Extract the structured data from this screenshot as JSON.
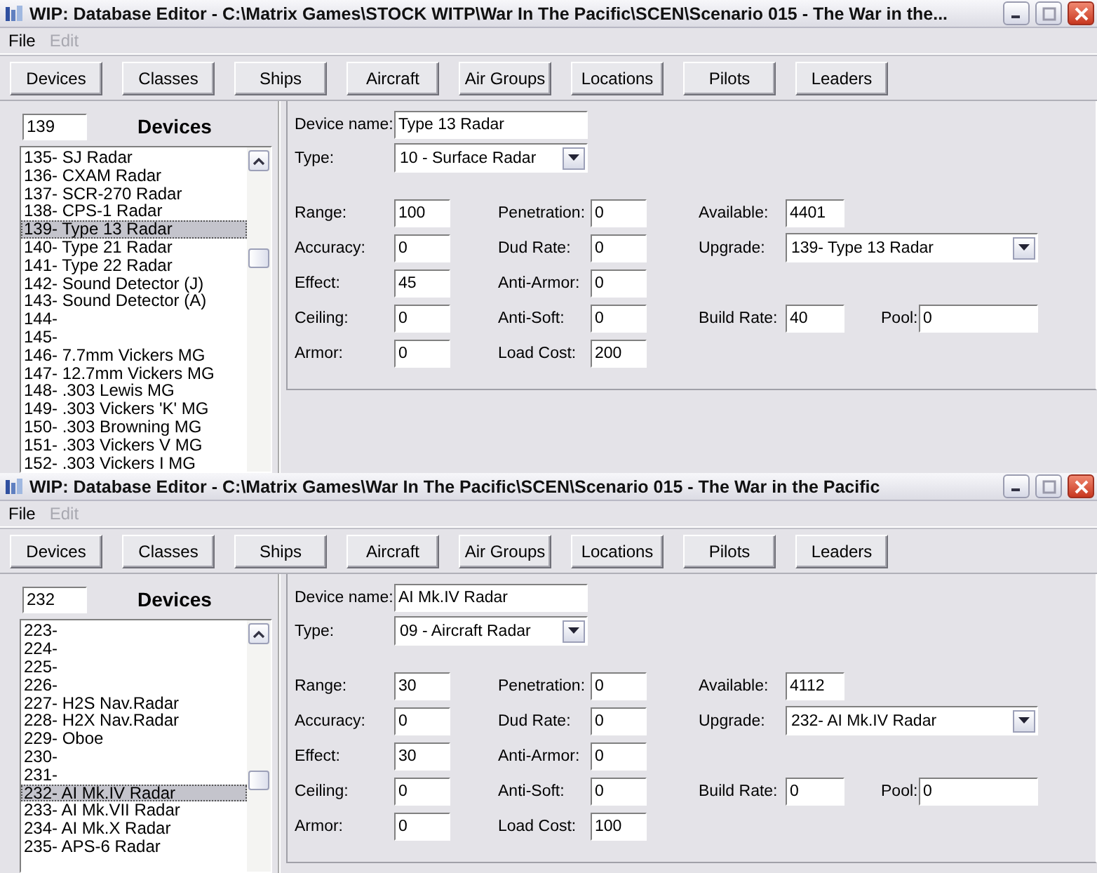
{
  "windows": [
    {
      "title": "WIP: Database Editor - C:\\Matrix Games\\STOCK WITP\\War In The Pacific\\SCEN\\Scenario 015 - The War in the...",
      "menu": [
        {
          "label": "File",
          "disabled": false
        },
        {
          "label": "Edit",
          "disabled": true
        }
      ],
      "nav_buttons": [
        "Devices",
        "Classes",
        "Ships",
        "Aircraft",
        "Air Groups",
        "Locations",
        "Pilots",
        "Leaders"
      ],
      "search": {
        "value": "139"
      },
      "list_title": "Devices",
      "list": [
        {
          "label": "135- SJ Radar",
          "selected": false
        },
        {
          "label": "136- CXAM Radar",
          "selected": false
        },
        {
          "label": "137- SCR-270 Radar",
          "selected": false
        },
        {
          "label": "138- CPS-1 Radar",
          "selected": false
        },
        {
          "label": "139- Type 13 Radar",
          "selected": true
        },
        {
          "label": "140- Type 21 Radar",
          "selected": false
        },
        {
          "label": "141- Type 22 Radar",
          "selected": false
        },
        {
          "label": "142- Sound Detector (J)",
          "selected": false
        },
        {
          "label": "143- Sound Detector (A)",
          "selected": false
        },
        {
          "label": "144-",
          "selected": false
        },
        {
          "label": "145-",
          "selected": false
        },
        {
          "label": "146- 7.7mm Vickers MG",
          "selected": false
        },
        {
          "label": "147- 12.7mm Vickers MG",
          "selected": false
        },
        {
          "label": "148- .303 Lewis MG",
          "selected": false
        },
        {
          "label": "149- .303 Vickers 'K' MG",
          "selected": false
        },
        {
          "label": "150- .303 Browning MG",
          "selected": false
        },
        {
          "label": "151- .303 Vickers V MG",
          "selected": false
        },
        {
          "label": "152- .303 Vickers I MG",
          "selected": false
        }
      ],
      "device_name": {
        "label": "Device name:",
        "value": "Type 13 Radar"
      },
      "type": {
        "label": "Type:",
        "value": "10 - Surface Radar"
      },
      "stat_rows": [
        [
          {
            "kind": "field",
            "label": "Range:",
            "value": "100"
          },
          {
            "kind": "field",
            "label": "Penetration:",
            "value": "0"
          },
          {
            "kind": "field",
            "label": "Available:",
            "value": "4401"
          },
          null
        ],
        [
          {
            "kind": "field",
            "label": "Accuracy:",
            "value": "0"
          },
          {
            "kind": "field",
            "label": "Dud Rate:",
            "value": "0"
          },
          {
            "kind": "dropdown",
            "label": "Upgrade:",
            "value": "139- Type 13 Radar"
          },
          null
        ],
        [
          {
            "kind": "field",
            "label": "Effect:",
            "value": "45"
          },
          {
            "kind": "field",
            "label": "Anti-Armor:",
            "value": "0"
          },
          null,
          null
        ],
        [
          {
            "kind": "field",
            "label": "Ceiling:",
            "value": "0"
          },
          {
            "kind": "field",
            "label": "Anti-Soft:",
            "value": "0"
          },
          {
            "kind": "field",
            "label": "Build Rate:",
            "value": "40"
          },
          {
            "kind": "field",
            "label": "Pool:",
            "value": "0"
          }
        ],
        [
          {
            "kind": "field",
            "label": "Armor:",
            "value": "0"
          },
          {
            "kind": "field",
            "label": "Load Cost:",
            "value": "200"
          },
          null,
          null
        ]
      ]
    },
    {
      "title": "WIP: Database Editor - C:\\Matrix Games\\War In The Pacific\\SCEN\\Scenario 015 - The War in the Pacific",
      "menu": [
        {
          "label": "File",
          "disabled": false
        },
        {
          "label": "Edit",
          "disabled": true
        }
      ],
      "nav_buttons": [
        "Devices",
        "Classes",
        "Ships",
        "Aircraft",
        "Air Groups",
        "Locations",
        "Pilots",
        "Leaders"
      ],
      "search": {
        "value": "232"
      },
      "list_title": "Devices",
      "list": [
        {
          "label": "223-",
          "selected": false
        },
        {
          "label": "224-",
          "selected": false
        },
        {
          "label": "225-",
          "selected": false
        },
        {
          "label": "226-",
          "selected": false
        },
        {
          "label": "227- H2S Nav.Radar",
          "selected": false
        },
        {
          "label": "228- H2X Nav.Radar",
          "selected": false
        },
        {
          "label": "229- Oboe",
          "selected": false
        },
        {
          "label": "230-",
          "selected": false
        },
        {
          "label": "231-",
          "selected": false
        },
        {
          "label": "232- AI Mk.IV Radar",
          "selected": true
        },
        {
          "label": "233- AI Mk.VII Radar",
          "selected": false
        },
        {
          "label": "234- AI Mk.X Radar",
          "selected": false
        },
        {
          "label": "235- APS-6 Radar",
          "selected": false
        }
      ],
      "device_name": {
        "label": "Device name:",
        "value": "AI Mk.IV Radar"
      },
      "type": {
        "label": "Type:",
        "value": "09 - Aircraft Radar"
      },
      "stat_rows": [
        [
          {
            "kind": "field",
            "label": "Range:",
            "value": "30"
          },
          {
            "kind": "field",
            "label": "Penetration:",
            "value": "0"
          },
          {
            "kind": "field",
            "label": "Available:",
            "value": "4112"
          },
          null
        ],
        [
          {
            "kind": "field",
            "label": "Accuracy:",
            "value": "0"
          },
          {
            "kind": "field",
            "label": "Dud Rate:",
            "value": "0"
          },
          {
            "kind": "dropdown",
            "label": "Upgrade:",
            "value": "232- AI Mk.IV Radar"
          },
          null
        ],
        [
          {
            "kind": "field",
            "label": "Effect:",
            "value": "30"
          },
          {
            "kind": "field",
            "label": "Anti-Armor:",
            "value": "0"
          },
          null,
          null
        ],
        [
          {
            "kind": "field",
            "label": "Ceiling:",
            "value": "0"
          },
          {
            "kind": "field",
            "label": "Anti-Soft:",
            "value": "0"
          },
          {
            "kind": "field",
            "label": "Build Rate:",
            "value": "0"
          },
          {
            "kind": "field",
            "label": "Pool:",
            "value": "0"
          }
        ],
        [
          {
            "kind": "field",
            "label": "Armor:",
            "value": "0"
          },
          {
            "kind": "field",
            "label": "Load Cost:",
            "value": "100"
          },
          null,
          null
        ]
      ]
    }
  ]
}
